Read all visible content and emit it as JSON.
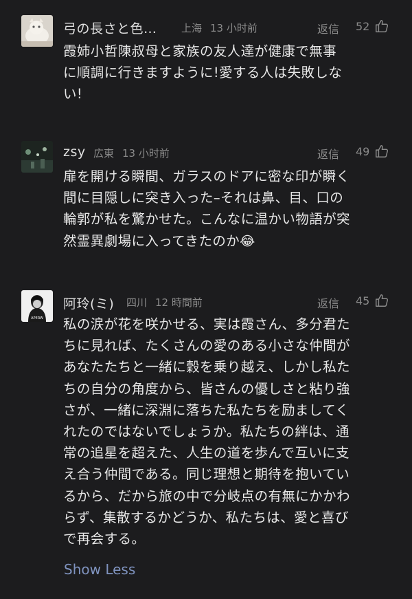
{
  "comments": [
    {
      "username": "弓の長さと色…",
      "location": "上海",
      "time": "13 小时前",
      "reply_label": "返信",
      "likes": "52",
      "text": "霞姉小哲陳叔母と家族の友人達が健康で無事\nに順調に行きますように!愛する人は失敗しな\nい!"
    },
    {
      "username": "zsy",
      "location": "広東",
      "time": "13 小时前",
      "reply_label": "返信",
      "likes": "49",
      "text": "扉を開ける瞬間、ガラスのドアに密な印が瞬く\n間に目隠しに突き入った–それは鼻、目、口の\n輪郭が私を驚かせた。こんなに温かい物語が突\n然霊異劇場に入ってきたのか",
      "emoji": "😂"
    },
    {
      "username": "阿玲(ミ)",
      "location": "四川",
      "time": "12 時間前",
      "reply_label": "返信",
      "likes": "45",
      "avatar_text": "APERW",
      "text": "私の涙が花を咲かせる、実は霞さん、多分君た\nちに見れば、たくさんの愛のある小さな仲間が\nあなたたちと一緒に穀を乗り越え、しかし私た\nちの自分の角度から、皆さんの優しさと粘り強\nさが、一緒に深淵に落ちた私たちを励ましてく\nれたのではないでしょうか。私たちの絆は、通\n常の追星を超えた、人生の道を歩んで互いに支\nえ合う仲間である。同じ理想と期待を抱いてい\nるから、だから旅の中で分岐点の有無にかかわ\nらず、集散するかどうか、私たちは、愛と喜び\nで再会する。"
    }
  ],
  "show_less_label": "Show Less",
  "colors": {
    "background": "#1c1c1e",
    "text": "#e6e6e6",
    "meta": "#8a8a8a",
    "link": "#7f93bf"
  }
}
